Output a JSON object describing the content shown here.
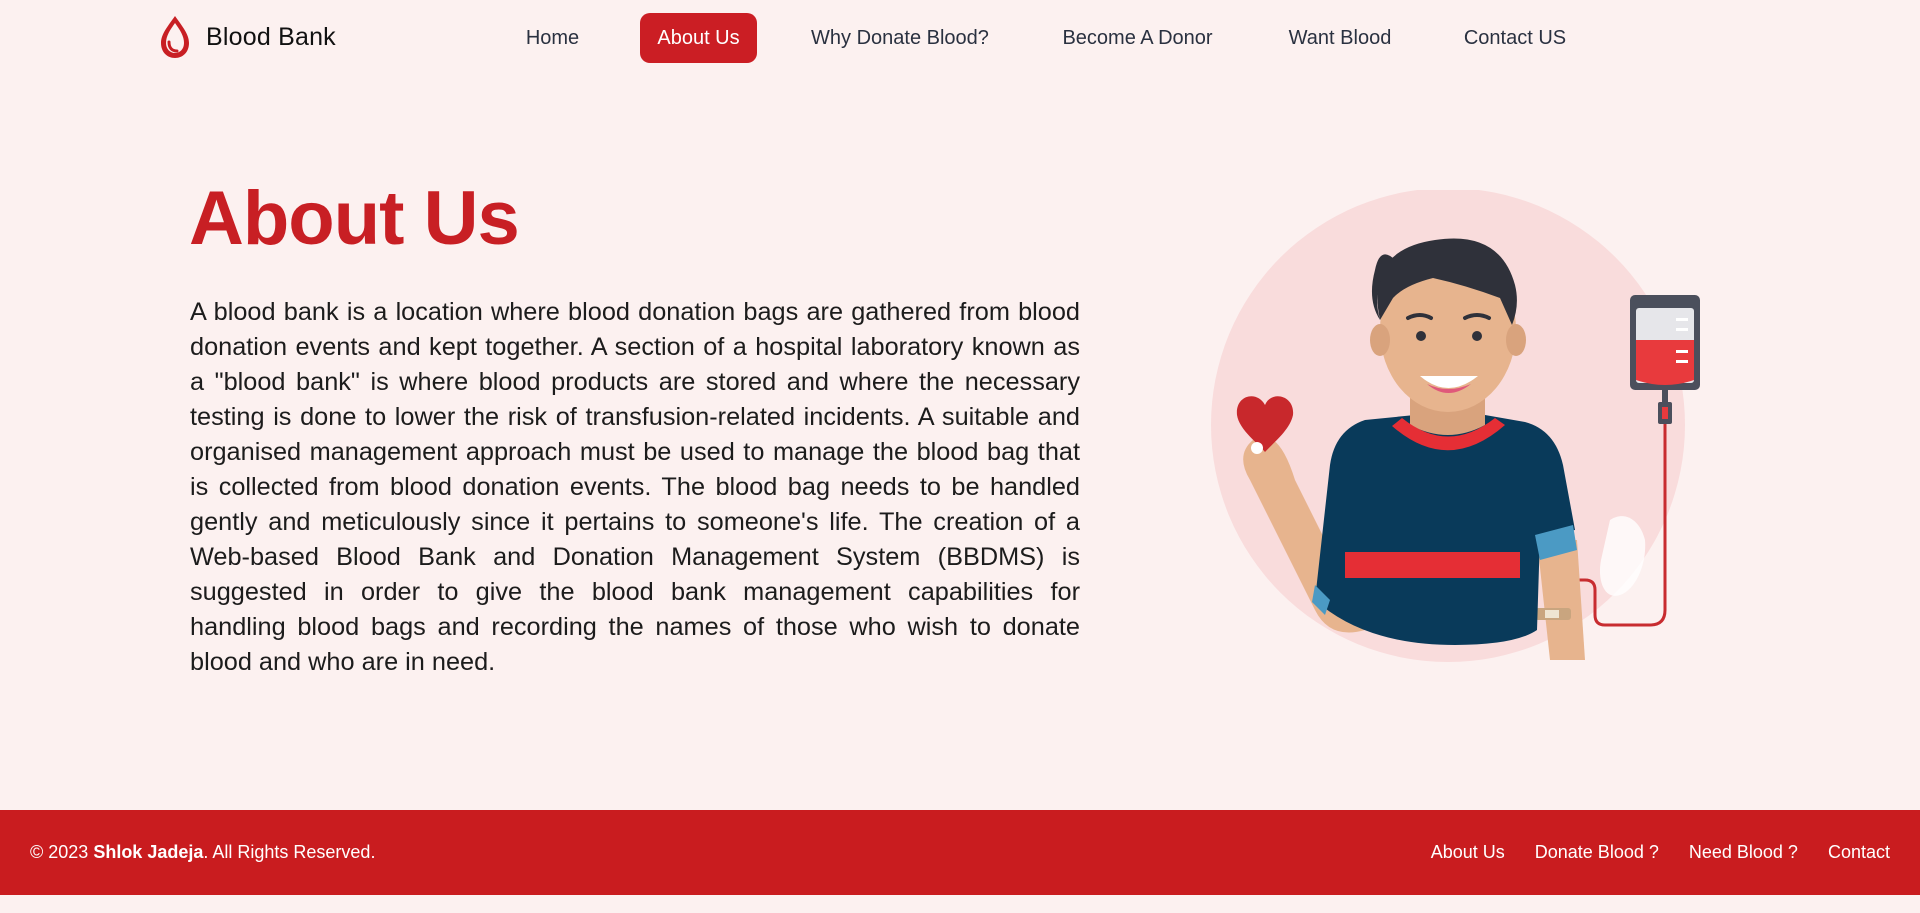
{
  "brand": {
    "name": "Blood Bank",
    "icon": "blood-drop-icon",
    "color": "#c81f24"
  },
  "nav": {
    "items": [
      {
        "label": "Home",
        "active": false
      },
      {
        "label": "About Us",
        "active": true
      },
      {
        "label": "Why Donate Blood?",
        "active": false
      },
      {
        "label": "Become A Donor",
        "active": false
      },
      {
        "label": "Want Blood",
        "active": false
      },
      {
        "label": "Contact US",
        "active": false
      }
    ]
  },
  "hero": {
    "title": "About Us",
    "paragraph": "A blood bank is a location where blood donation bags are gathered from blood donation events and kept together. A section of a hospital laboratory known as a \"blood bank\" is where blood products are stored and where the necessary testing is done to lower the risk of transfusion-related incidents. A suitable and organised management approach must be used to manage the blood bag that is collected from blood donation events. The blood bag needs to be handled gently and meticulously since it pertains to someone's life. The creation of a Web-based Blood Bank and Donation Management System (BBDMS) is suggested in order to give the blood bank management capabilities for handling blood bags and recording the names of those who wish to donate blood and who are in need.",
    "illustration": "blood-donor-illustration"
  },
  "footer": {
    "copyright_prefix": "© 2023 ",
    "author": "Shlok Jadeja",
    "copyright_suffix": ". All Rights Reserved.",
    "links": [
      "About Us",
      "Donate Blood ?",
      "Need Blood ?",
      "Contact"
    ]
  },
  "colors": {
    "background": "#fcf1f0",
    "accent": "#c91c1f",
    "nav_text": "#2a3140"
  }
}
